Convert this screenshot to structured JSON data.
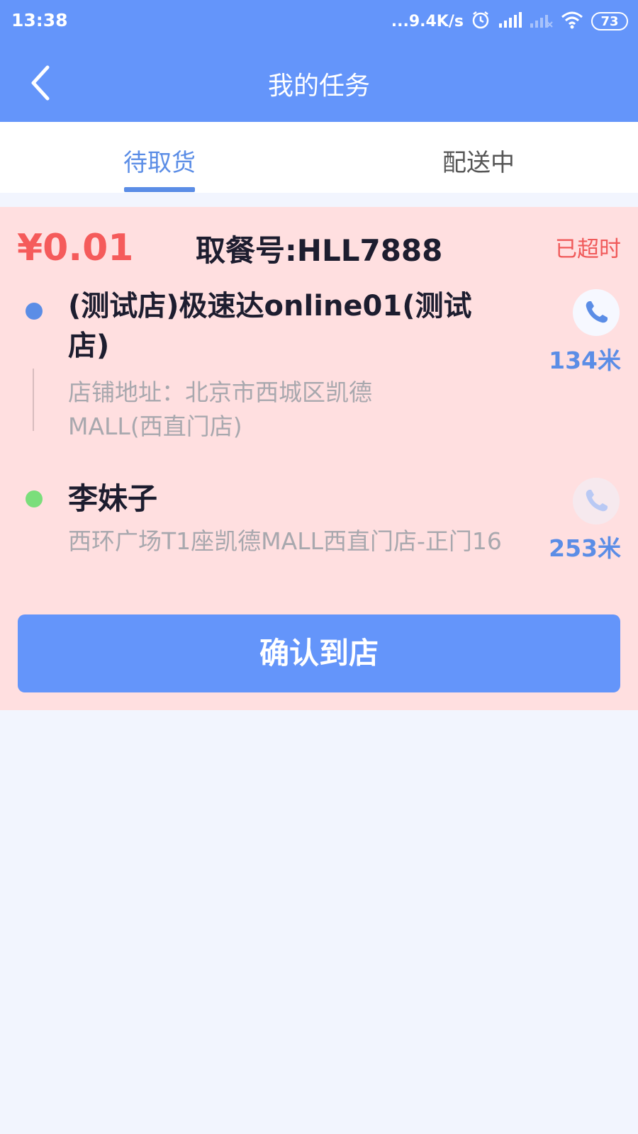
{
  "status_bar": {
    "time": "13:38",
    "net_speed": "...9.4K/s",
    "battery": "73",
    "icons": [
      "alarm-icon",
      "signal-icon",
      "signal-off-icon",
      "wifi-icon",
      "battery-icon"
    ]
  },
  "nav": {
    "title": "我的任务",
    "back_icon": "chevron-left-icon"
  },
  "tabs": [
    {
      "label": "待取货",
      "active": true
    },
    {
      "label": "配送中",
      "active": false
    }
  ],
  "order": {
    "price": "¥0.01",
    "pickup_code": "取餐号:HLL7888",
    "status": "已超时",
    "store": {
      "name": "(测试店)极速达online01(测试店)",
      "address": "店铺地址：北京市西城区凯德MALL(西直门店)",
      "distance": "134米"
    },
    "customer": {
      "name": "李妹子",
      "address": "西环广场T1座凯德MALL西直门店-正门16",
      "distance": "253米"
    },
    "confirm_label": "确认到店"
  },
  "colors": {
    "primary": "#6495fa",
    "card_background": "#ffdfe0",
    "price_red": "#f55b5b",
    "store_dot": "#5b8de6",
    "customer_dot": "#7bde7b"
  }
}
